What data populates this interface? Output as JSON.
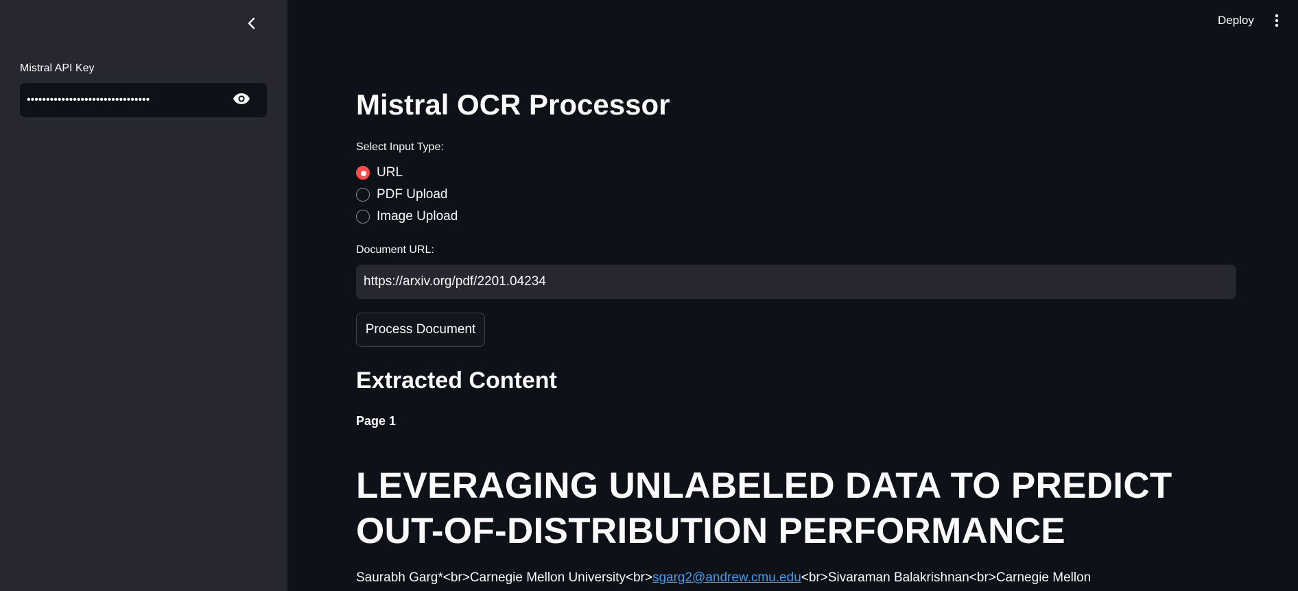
{
  "sidebar": {
    "api_key_label": "Mistral API Key",
    "api_key_value": "••••••••••••••••••••••••••••••••"
  },
  "header": {
    "deploy_label": "Deploy"
  },
  "main": {
    "title": "Mistral OCR Processor",
    "input_type_label": "Select Input Type:",
    "input_types": [
      "URL",
      "PDF Upload",
      "Image Upload"
    ],
    "selected_input_type": "URL",
    "document_url_label": "Document URL:",
    "document_url_value": "https://arxiv.org/pdf/2201.04234",
    "process_button_label": "Process Document",
    "extracted_heading": "Extracted Content",
    "page_label": "Page 1",
    "doc_title": "LEVERAGING UNLABELED DATA TO PREDICT OUT-OF-DISTRIBUTION PERFORMANCE",
    "authors_prefix": "Saurabh Garg*<br>Carnegie Mellon University<br>",
    "authors_email": "sgarg2@andrew.cmu.edu",
    "authors_suffix": "<br>Sivaraman Balakrishnan<br>Carnegie Mellon"
  },
  "colors": {
    "background": "#0e1117",
    "sidebar": "#262730",
    "accent": "#ff4b4b",
    "link": "#3d9df3"
  }
}
